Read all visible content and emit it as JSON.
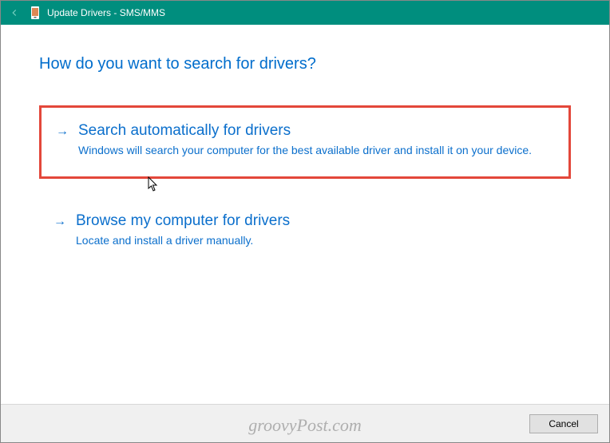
{
  "titlebar": {
    "title": "Update Drivers - SMS/MMS"
  },
  "heading": "How do you want to search for drivers?",
  "options": [
    {
      "title": "Search automatically for drivers",
      "desc": "Windows will search your computer for the best available driver and install it on your device."
    },
    {
      "title": "Browse my computer for drivers",
      "desc": "Locate and install a driver manually."
    }
  ],
  "footer": {
    "cancel": "Cancel"
  },
  "watermark": "groovyPost.com"
}
